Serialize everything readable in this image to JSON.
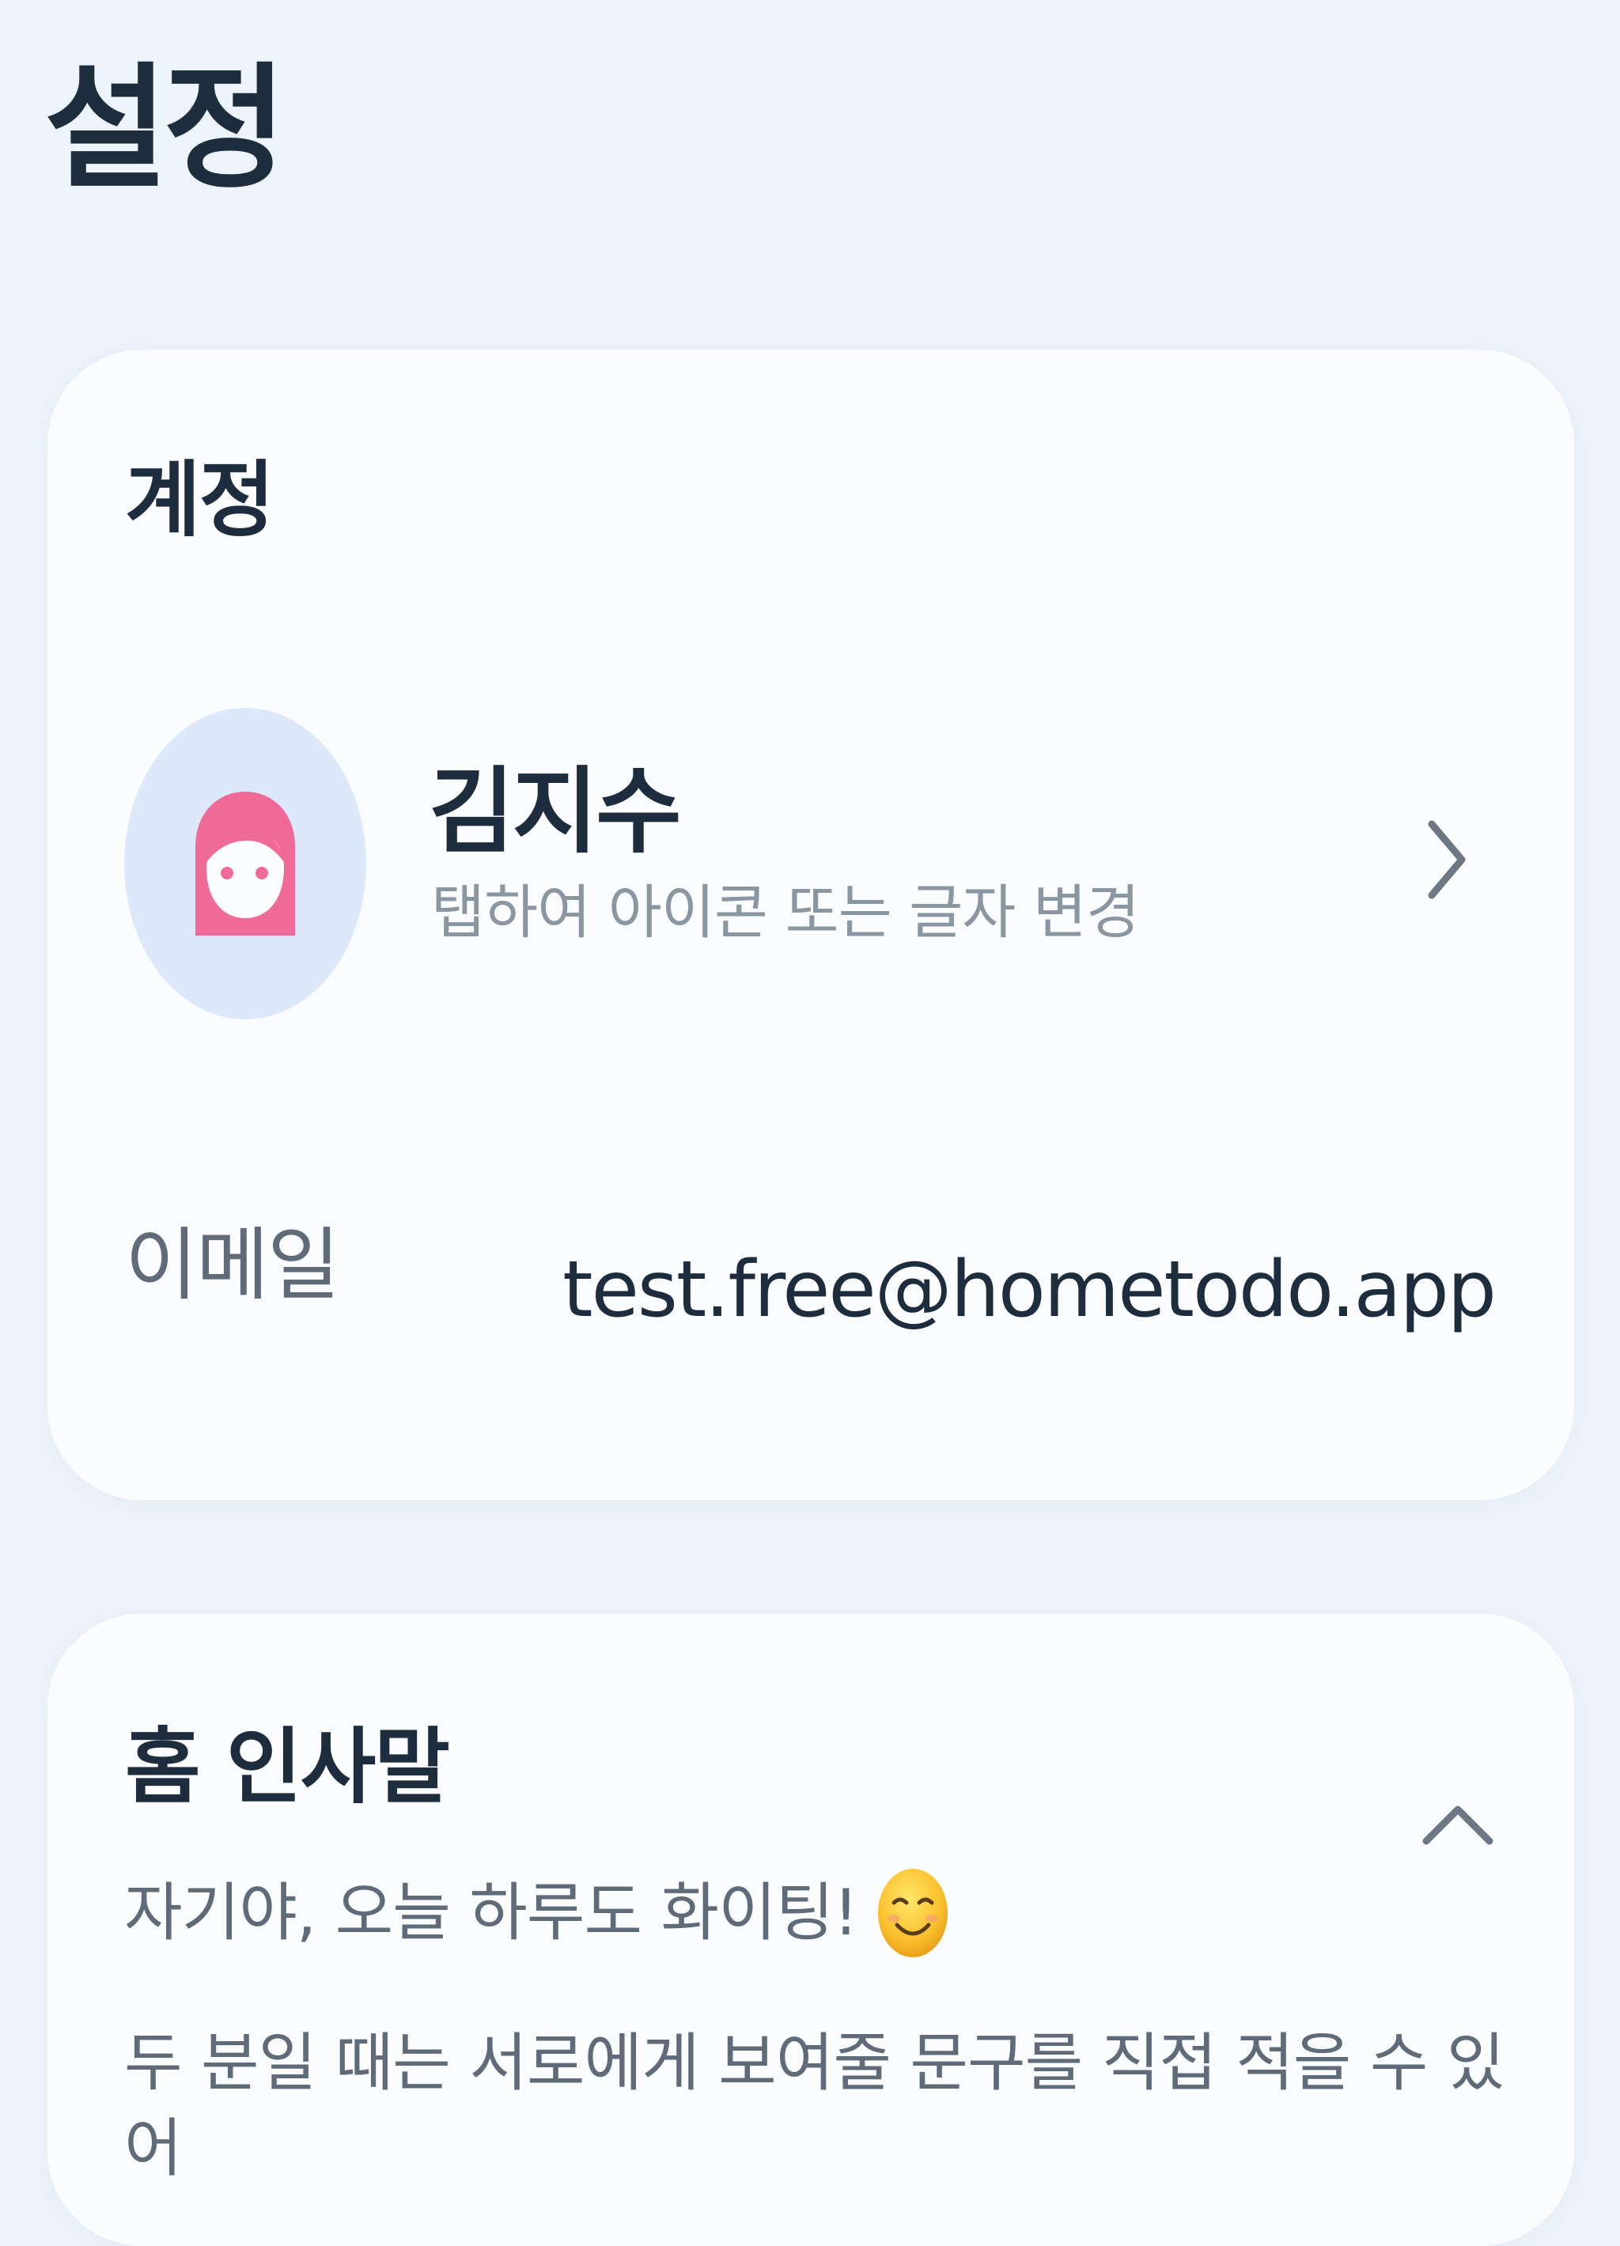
{
  "header": {
    "title": "설정"
  },
  "account": {
    "section_title": "계정",
    "profile": {
      "name": "김지수",
      "hint": "탭하여 아이콘 또는 글자 변경",
      "avatar_icon": "girl-face-icon",
      "avatar_color": "#f06a98",
      "avatar_bg": "#dde9fb"
    },
    "email": {
      "label": "이메일",
      "value": "test.free@hometodo.app"
    }
  },
  "greeting": {
    "section_title": "홈 인사말",
    "text": "자기야, 오늘 하루도 화이팅!",
    "emoji_icon": "smiling-face-icon",
    "description": "두 분일 때는 서로에게 보여줄 문구를 직접 적을 수 있어"
  },
  "colors": {
    "background": "#eef4fb",
    "card": "#fbfcfe",
    "primary_text": "#1e2d3e",
    "secondary_text": "#5f6b79",
    "hint_text": "#8b96a3"
  }
}
